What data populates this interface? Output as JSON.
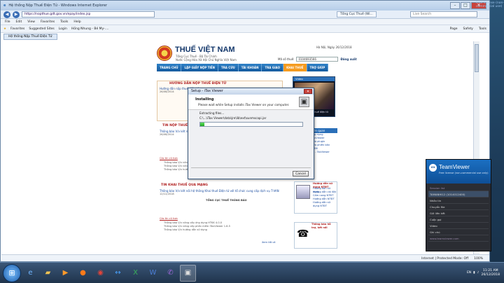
{
  "window": {
    "title": "Hệ thống Nộp Thuế Điện Tử - Windows Internet Explorer",
    "url": "https://nopthue.gdt.gov.vn/epay/index.jsp",
    "tabs": [
      "Tổng Cục Thuế (Wi...",
      "..."
    ],
    "search_placeholder": "Live Search",
    "menu": [
      "File",
      "Edit",
      "View",
      "Favorites",
      "Tools",
      "Help"
    ],
    "favorites": [
      "Favorites",
      "Suggested Sites",
      "Login",
      "Hồng Nhung - Bé My-...."
    ],
    "fav_right": [
      "Page",
      "Safety",
      "Tools"
    ],
    "page_tab": "Hệ thống Nộp Thuế Điện Tử",
    "status": [
      "Internet | Protected Mode: Off",
      "100%"
    ]
  },
  "site": {
    "brand": "THUẾ VIỆT NAM",
    "sub1": "Tổng Cục Thuế - Bộ Tài Chính",
    "sub2": "Nước Cộng Hòa Xã Hội Chủ Nghĩa Việt Nam",
    "head_right": "Hà Nội, Ngày 26/12/2018",
    "mst_label": "Mã số thuế:",
    "mst_value": "0104693566",
    "logout": "Đăng xuất",
    "nav": [
      "TRANG CHỦ",
      "LẬP GIẤY NỘP TIỀN",
      "TRA CỨU",
      "TÀI KHOẢN",
      "TRA GIAO",
      "KHAI THUẾ",
      "TRỢ GIÚP"
    ],
    "nav_active_index": 5,
    "left": {
      "guide_title": "HƯỚNG DẪN NỘP THUẾ ĐIỆN TỬ",
      "guide_link": "Hướng dẫn nộp thuế điện tử",
      "guide_date": "26/08/2014",
      "notice_title": "TIN NỘP THUẾ ĐIỆN TỬ",
      "notice_link": "Thông báo V/v kết nối hệ thống nộp thuế điện tử",
      "notice_date": "26/08/2014",
      "declare_title": "TIN KHAI THUẾ QUA MẠNG",
      "declare_link": "Thông báo V/v kết nối hệ thống Khai thuế Điện tử với tổ chức cung cấp dịch vụ T-VAN",
      "declare_date": "12/12/2018",
      "tongcuc": "TỔNG CỤC THUẾ THÔNG BÁO",
      "more": "Xem tất cả",
      "other_head": "Các tin cũ hơn",
      "other": [
        "Thông báo V/v nâng cấp ứng dụng HTKK 4.0.0",
        "Thông báo V/v nâng cấp phần mềm iTaxViewer 1.6.5",
        "Thông báo V/v hướng dẫn sử dụng"
      ]
    },
    "right": {
      "video_head": "Video",
      "video_caption": "Hướng dẫn nộp thuế điện tử",
      "links_head": "Phần mềm liên quan",
      "links": [
        "Phần mềm ứng dụng",
        "Phần mềm iTaxViewer",
        "Phần mềm Java plugin",
        "Phần mềm Java phiên bản",
        "Phần mềm HTKK",
        "Phần mềm KK - TaxViewer"
      ],
      "guide_head": "Hướng dẫn sử dụng NTĐT",
      "guide_items": [
        "Hướng dẫn sử dụng",
        "Hướng dẫn cài đặt",
        "Cẩm nang NTĐT",
        "Hướng dẫn NTĐT",
        "Hướng dẫn sử dụng NTĐT"
      ],
      "support_head": "Thông báo hỗ trợ, kết nối"
    }
  },
  "dialog": {
    "title": "Setup - iTax Viewer",
    "heading": "Installing",
    "subheading": "Please wait while Setup installs iTax Viewer on your computer.",
    "extracting": "Extracting files...",
    "path": "C:\\...\\iTax Viewer\\data\\jre\\lib\\ext\\sunmscapi.jar",
    "progress": 0.04,
    "cancel": "Cancel"
  },
  "teamviewer": {
    "brand": "TeamViewer",
    "subtitle": "Free license (non-commercial use only)",
    "rows": [
      "Session list",
      "TAMANHI12 (1014012400)",
      "Nhắn tin",
      "Chuyển file",
      "Gửi liên kết",
      "Cuộc gọi",
      "Video",
      "Ghi chú",
      "Chat"
    ],
    "footer": "www.teamviewer.com"
  },
  "taskbar": {
    "apps": [
      "ie",
      "folder",
      "media",
      "firefox",
      "chrome",
      "teamviewer",
      "excel",
      "word",
      "viber",
      "setup"
    ],
    "lang": "EN",
    "time": "11:21 AM",
    "date": "26/12/2018"
  },
  "top_link": "Free license (non-commercial use)"
}
